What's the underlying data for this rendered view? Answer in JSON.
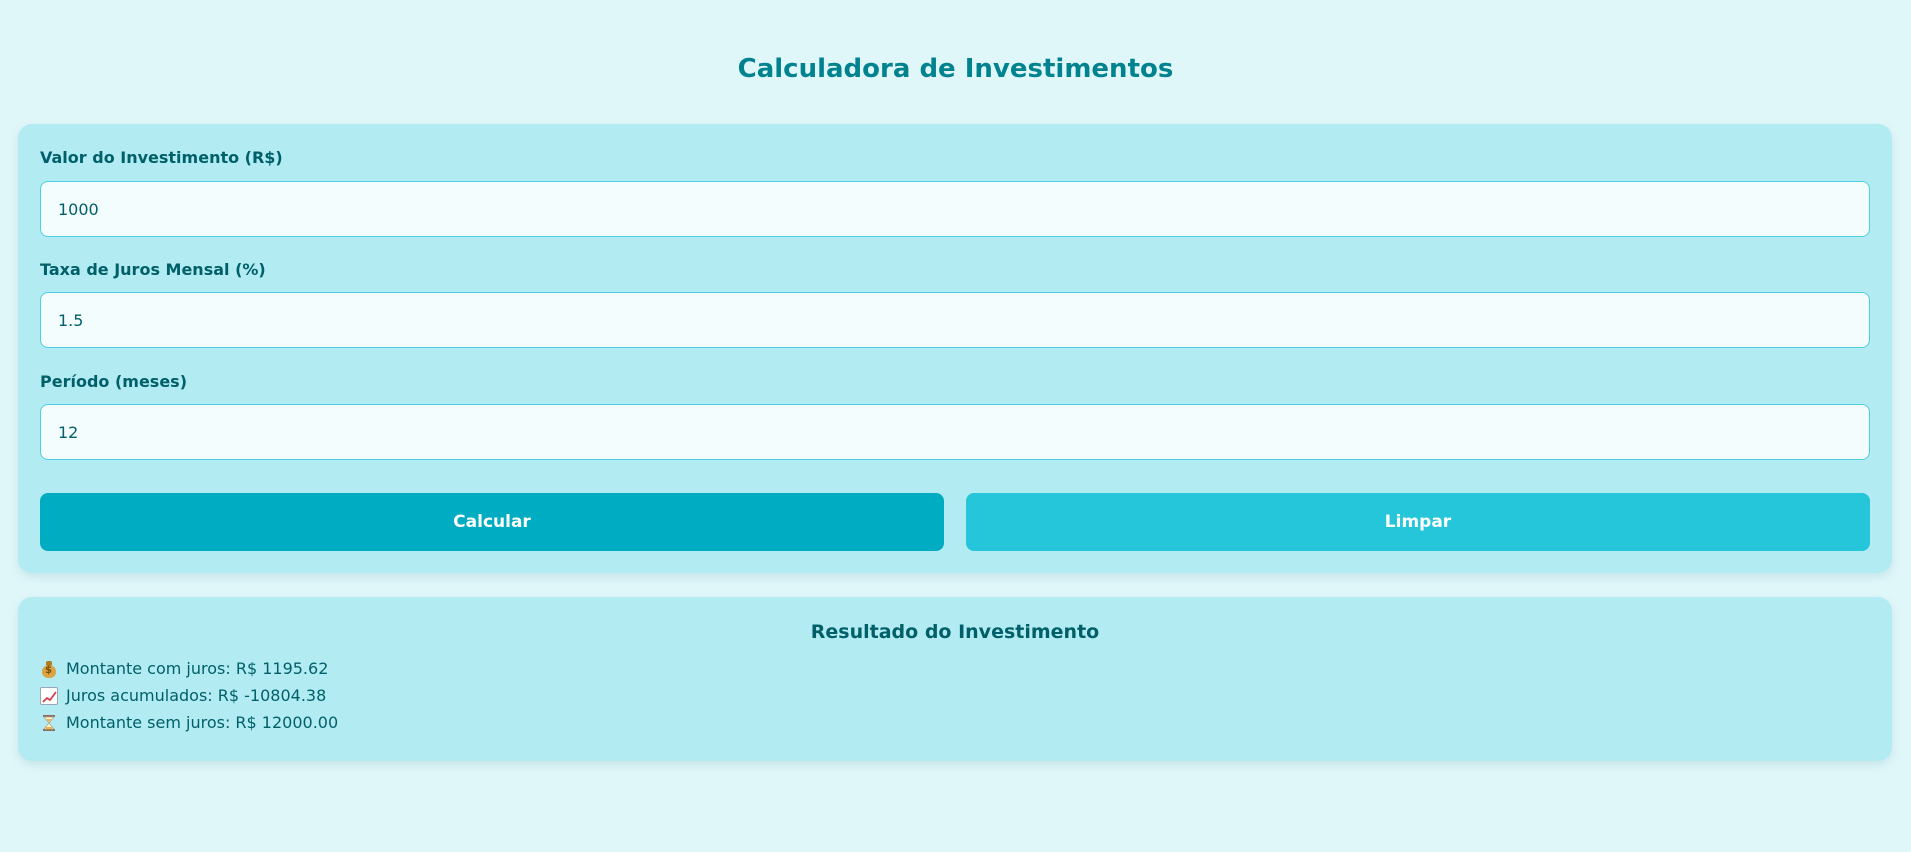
{
  "page": {
    "title": "Calculadora de Investimentos"
  },
  "form": {
    "fields": [
      {
        "label": "Valor do Investimento (R$)",
        "value": "1000"
      },
      {
        "label": "Taxa de Juros Mensal (%)",
        "value": "1.5"
      },
      {
        "label": "Período (meses)",
        "value": "12"
      }
    ],
    "buttons": {
      "calculate": "Calcular",
      "clear": "Limpar"
    }
  },
  "result": {
    "title": "Resultado do Investimento",
    "lines": [
      {
        "icon": "money-bag-icon",
        "text": "Montante com juros: R$ 1195.62"
      },
      {
        "icon": "chart-increasing-icon",
        "text": "Juros acumulados: R$ -10804.38"
      },
      {
        "icon": "hourglass-icon",
        "text": "Montante sem juros: R$ 12000.00"
      }
    ]
  },
  "colors": {
    "background": "#e0f7fa",
    "card": "#b2ebf2",
    "title": "#00838f",
    "text": "#00606a",
    "button_primary": "#00acc1",
    "button_secondary": "#26c6da",
    "input_border": "#4dd0e1"
  }
}
